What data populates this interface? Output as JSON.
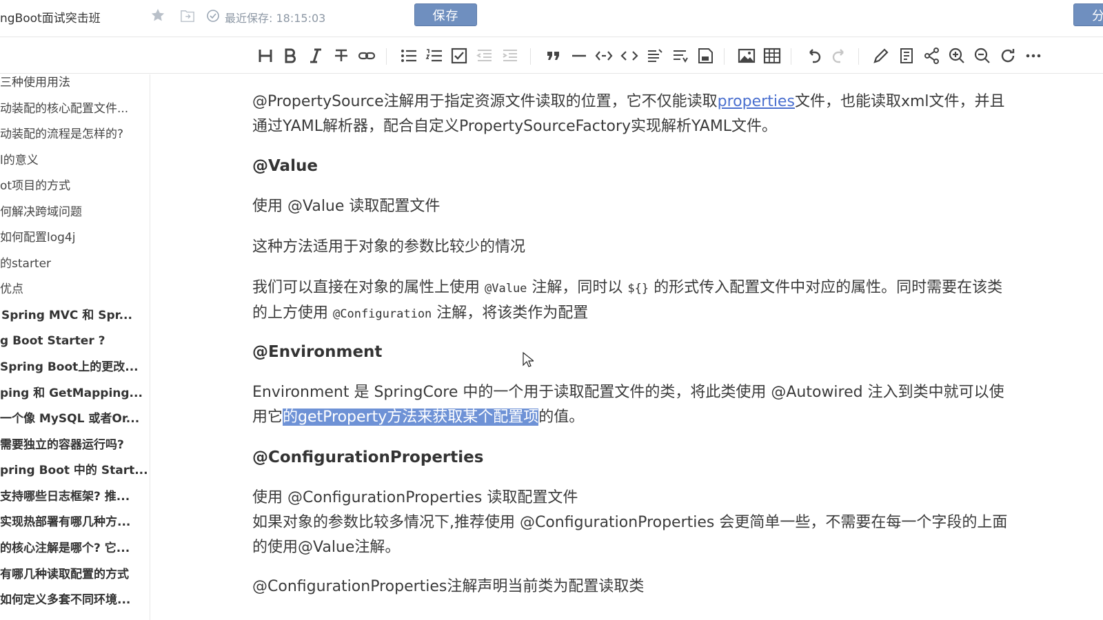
{
  "header": {
    "doc_title": "ngBoot面试突击班",
    "saved_status": "最近保存: 18:15:03",
    "save_label": "保存",
    "share_label": "分"
  },
  "toolbar": {
    "icons": [
      "heading-icon",
      "bold-icon",
      "italic-icon",
      "strikethrough-icon",
      "link-icon",
      "bullet-list-icon",
      "ordered-list-icon",
      "checklist-icon",
      "outdent-icon",
      "indent-icon",
      "quote-icon",
      "horizontal-rule-icon",
      "inline-code-icon",
      "code-block-icon",
      "table-of-contents-icon",
      "align-icon",
      "save-disk-icon",
      "image-icon",
      "table-icon",
      "undo-icon",
      "redo-icon",
      "edit-icon",
      "notes-icon",
      "share-icon",
      "zoom-in-icon",
      "zoom-out-icon",
      "refresh-icon",
      "more-icon"
    ]
  },
  "sidebar": {
    "items": [
      {
        "label": "三种使用用法",
        "bold": false
      },
      {
        "label": "动装配的核心配置文件...",
        "bold": false
      },
      {
        "label": "动装配的流程是怎样的?",
        "bold": false
      },
      {
        "label": "l的意义",
        "bold": false
      },
      {
        "label": "ot项目的方式",
        "bold": false
      },
      {
        "label": "何解决跨域问题",
        "bold": false
      },
      {
        "label": "如何配置log4j",
        "bold": false
      },
      {
        "label": "的starter",
        "bold": false
      },
      {
        "label": "优点",
        "bold": false
      },
      {
        "label": "  Spring MVC 和 Spr...",
        "bold": true
      },
      {
        "label": "g Boot Starter ?",
        "bold": true
      },
      {
        "label": "Spring Boot上的更改...",
        "bold": true
      },
      {
        "label": "ping 和 GetMapping...",
        "bold": true
      },
      {
        "label": "一个像 MySQL 或者Or...",
        "bold": true
      },
      {
        "label": "需要独立的容器运行吗?",
        "bold": true
      },
      {
        "label": "pring Boot 中的 Start...",
        "bold": true
      },
      {
        "label": "支持哪些日志框架? 推...",
        "bold": true
      },
      {
        "label": "实现热部署有哪几种方...",
        "bold": true
      },
      {
        "label": "的核心注解是哪个? 它...",
        "bold": true
      },
      {
        "label": "有哪几种读取配置的方式",
        "bold": true
      },
      {
        "label": "如何定义多套不同环境...",
        "bold": true
      }
    ]
  },
  "content": {
    "p1_a": "@PropertySource注解用于指定资源文件读取的位置，它不仅能读取",
    "p1_link": "properties",
    "p1_b": "文件，也能读取xml文件，并且",
    "p1_line2": "通过YAML解析器，配合自定义PropertySourceFactory实现解析YAML文件。",
    "h_value": "@Value",
    "p2": "使用 @Value 读取配置文件",
    "p3": "这种方法适用于对象的参数比较少的情况",
    "p4_a": "我们可以直接在对象的属性上使用 ",
    "p4_code1": "@Value",
    "p4_b": " 注解，同时以 ",
    "p4_code2": "${}",
    "p4_c": " 的形式传入配置文件中对应的属性。同时需要在该类",
    "p4_d": "的上方使用 ",
    "p4_code3": "@Configuration",
    "p4_e": " 注解，将该类作为配置",
    "h_env": "@Environment",
    "p5_line1": "Environment 是 SpringCore 中的一个用于读取配置文件的类，将此类使用 @Autowired 注入到类中就可以使",
    "p5_a": "用它",
    "p5_hl": "的getProperty方法来获取某个配置项",
    "p5_b": "的值。",
    "h_cp": "@ConfigurationProperties",
    "p6_line1": "使用 @ConfigurationProperties 读取配置文件",
    "p6_line2": "如果对象的参数比较多情况下,推荐使用 @ConfigurationProperties 会更简单一些，不需要在每一个字段的上面",
    "p6_line3": "的使用@Value注解。",
    "p7": "@ConfigurationProperties注解声明当前类为配置读取类"
  }
}
